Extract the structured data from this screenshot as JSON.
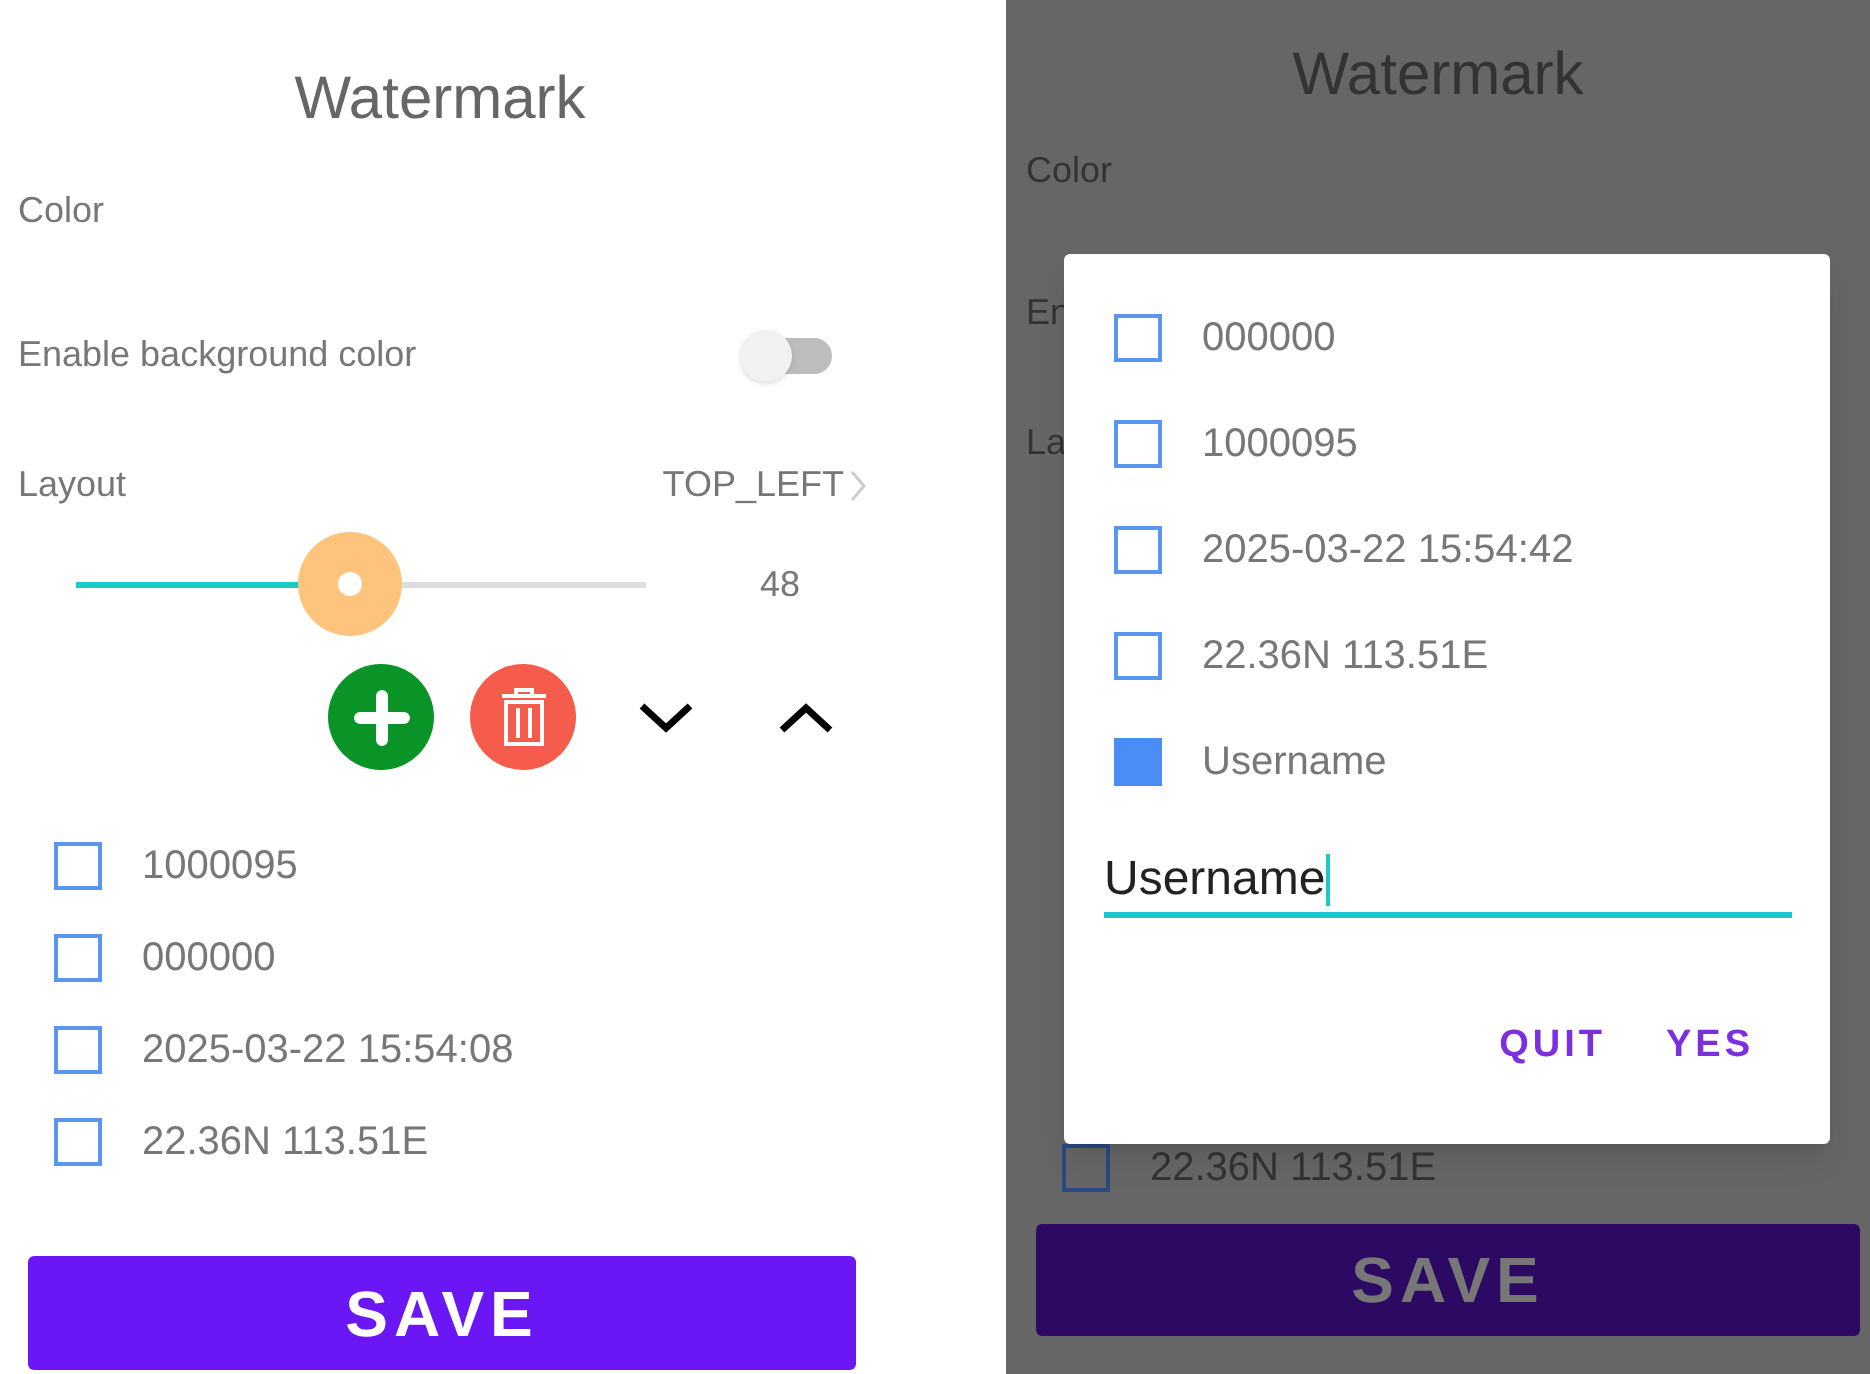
{
  "settings_screen": {
    "title": "Watermark",
    "color_label": "Color",
    "background_toggle": {
      "label": "Enable background color",
      "on": false
    },
    "layout_row": {
      "label": "Layout",
      "value": "TOP_LEFT"
    },
    "size_slider": {
      "level": 0.48,
      "reading": "48"
    },
    "items": [
      {
        "text": "1000095",
        "checked": false
      },
      {
        "text": "000000",
        "checked": false
      },
      {
        "text": "2025-03-22 15:54:08",
        "checked": false
      },
      {
        "text": "22.36N 113.51E",
        "checked": false
      }
    ],
    "save_button": "SAVE"
  },
  "dialog_screen": {
    "title": "Watermark",
    "color_label": "Color",
    "toggle_label_visible": "En",
    "layout_label_visible": "La",
    "items": [
      {
        "text": "22.36N 113.51E",
        "checked": false
      }
    ],
    "save_button": "SAVE",
    "dialog": {
      "items": [
        {
          "text": "000000",
          "checked": false
        },
        {
          "text": "1000095",
          "checked": false
        },
        {
          "text": "2025-03-22 15:54:42",
          "checked": false
        },
        {
          "text": "22.36N 113.51E",
          "checked": false
        },
        {
          "text": "Username",
          "checked": true
        }
      ],
      "input_value": "Username",
      "buttons": [
        "QUIT",
        "YES"
      ]
    }
  }
}
